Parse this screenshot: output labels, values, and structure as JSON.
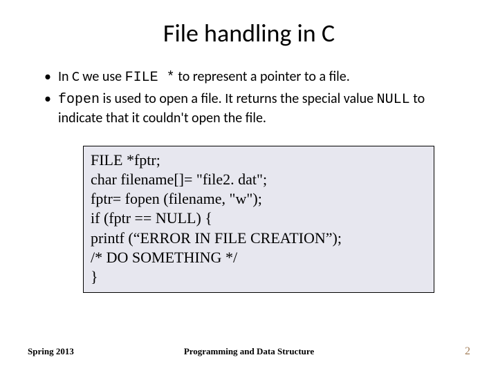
{
  "title": "File handling in C",
  "bullets": {
    "b1_part1": "In C we use ",
    "b1_code": "FILE *",
    "b1_part2": " to represent a pointer to a file.",
    "b2_code1": "fopen",
    "b2_part1": " is used to open a file.  It returns the special value ",
    "b2_code2": "NULL",
    "b2_part2": " to indicate that it couldn't open the file."
  },
  "code": {
    "l1": "FILE *fptr;",
    "l2": "char filename[]= \"file2. dat\";",
    "l3": "fptr= fopen (filename, \"w\");",
    "l4": "if (fptr  == NULL) {",
    "l5": "   printf (“ERROR IN FILE CREATION”);",
    "l6": "        /* DO SOMETHING */",
    "l7": "}"
  },
  "footer": {
    "left": "Spring 2013",
    "center": "Programming and Data Structure",
    "right": "2"
  }
}
